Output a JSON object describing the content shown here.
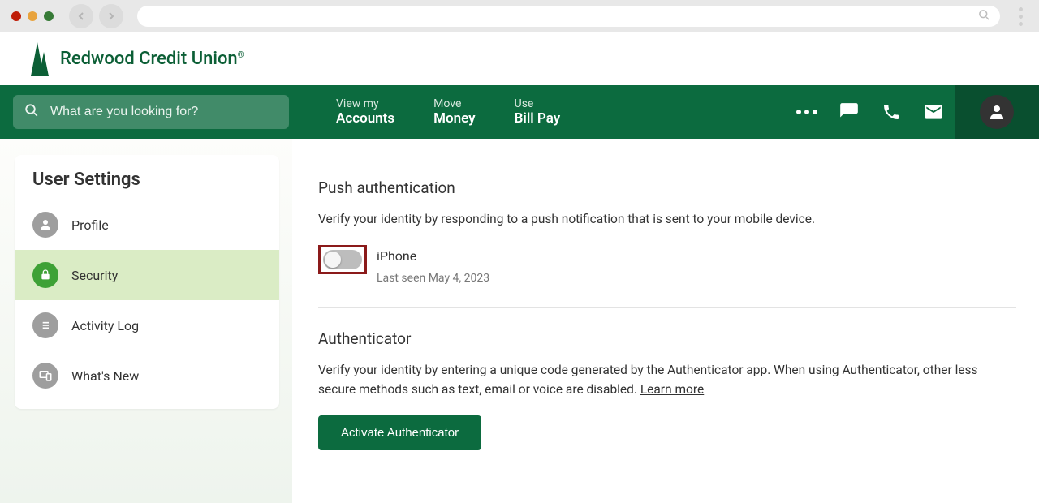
{
  "brand": {
    "name": "Redwood Credit Union"
  },
  "search": {
    "placeholder": "What are you looking for?"
  },
  "nav": {
    "items": [
      {
        "pre": "View my",
        "main": "Accounts"
      },
      {
        "pre": "Move",
        "main": "Money"
      },
      {
        "pre": "Use",
        "main": "Bill Pay"
      }
    ]
  },
  "sidebar": {
    "title": "User Settings",
    "items": [
      {
        "label": "Profile"
      },
      {
        "label": "Security"
      },
      {
        "label": "Activity Log"
      },
      {
        "label": "What's New"
      }
    ]
  },
  "push": {
    "title": "Push authentication",
    "desc": "Verify your identity by responding to a push notification that is sent to your mobile device.",
    "device_name": "iPhone",
    "device_sub": "Last seen May 4, 2023"
  },
  "auth": {
    "title": "Authenticator",
    "desc_part1": "Verify your identity by entering a unique code generated by the Authenticator app. When using Authenticator, other less secure methods such as text, email or voice are disabled. ",
    "learn_more": "Learn more",
    "button": "Activate Authenticator"
  }
}
